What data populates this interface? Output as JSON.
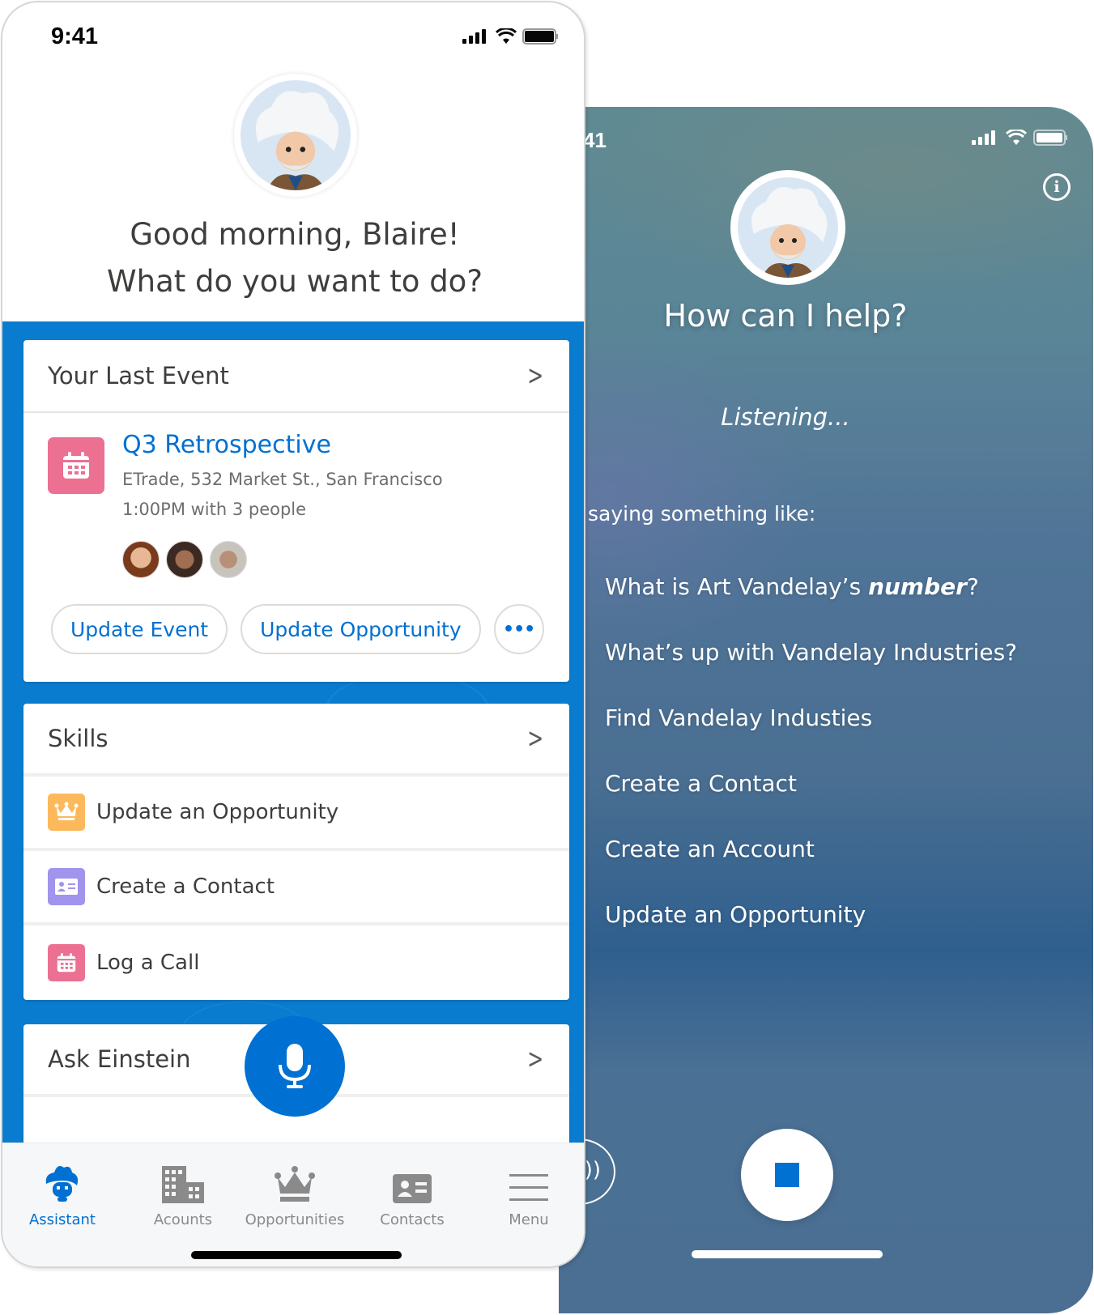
{
  "voice_screen": {
    "status_time": "41",
    "title": "How can I help?",
    "listening": "Listening...",
    "hint": "saying something like:",
    "suggestions": [
      {
        "pre": "What is Art Vandelay’s ",
        "em": "number",
        "post": "?"
      },
      {
        "pre": "What’s up with Vandelay Industries?",
        "em": "",
        "post": ""
      },
      {
        "pre": "Find Vandelay Industies",
        "em": "",
        "post": ""
      },
      {
        "pre": "Create a Contact",
        "em": "",
        "post": ""
      },
      {
        "pre": "Create an Account",
        "em": "",
        "post": ""
      },
      {
        "pre": "Update an Opportunity",
        "em": "",
        "post": ""
      }
    ],
    "info_glyph": "i",
    "speaker_glyph": "))",
    "stop_icon": "stop-icon"
  },
  "home_screen": {
    "status_time": "9:41",
    "greeting_line1": "Good morning, Blaire!",
    "greeting_line2": "What do you want to do?",
    "last_event": {
      "header": "Your Last Event",
      "title": "Q3 Retrospective",
      "location": "ETrade, 532 Market St., San Francisco",
      "time": "1:00PM with 3 people",
      "attendee_count": 3,
      "actions": [
        "Update Event",
        "Update Opportunity"
      ],
      "more_glyph": "•••"
    },
    "skills": {
      "header": "Skills",
      "items": [
        {
          "label": "Update an Opportunity",
          "icon": "crown-icon",
          "color": "#fcb95b"
        },
        {
          "label": "Create a Contact",
          "icon": "contact-card-icon",
          "color": "#a094ed"
        },
        {
          "label": "Log a Call",
          "icon": "calendar-icon",
          "color": "#eb7092"
        }
      ]
    },
    "ask_einstein": {
      "header": "Ask Einstein"
    },
    "tabs": [
      {
        "label": "Assistant",
        "active": true
      },
      {
        "label": "Acounts",
        "active": false
      },
      {
        "label": "Opportunities",
        "active": false
      },
      {
        "label": "Contacts",
        "active": false
      },
      {
        "label": "Menu",
        "active": false
      }
    ],
    "chevron_glyph": ">"
  },
  "colors": {
    "brand_blue": "#0070d2",
    "background_blue": "#0a7cd0",
    "event_pink": "#eb7092",
    "text_dark": "#3e3e3c",
    "text_muted": "#706e6b"
  }
}
